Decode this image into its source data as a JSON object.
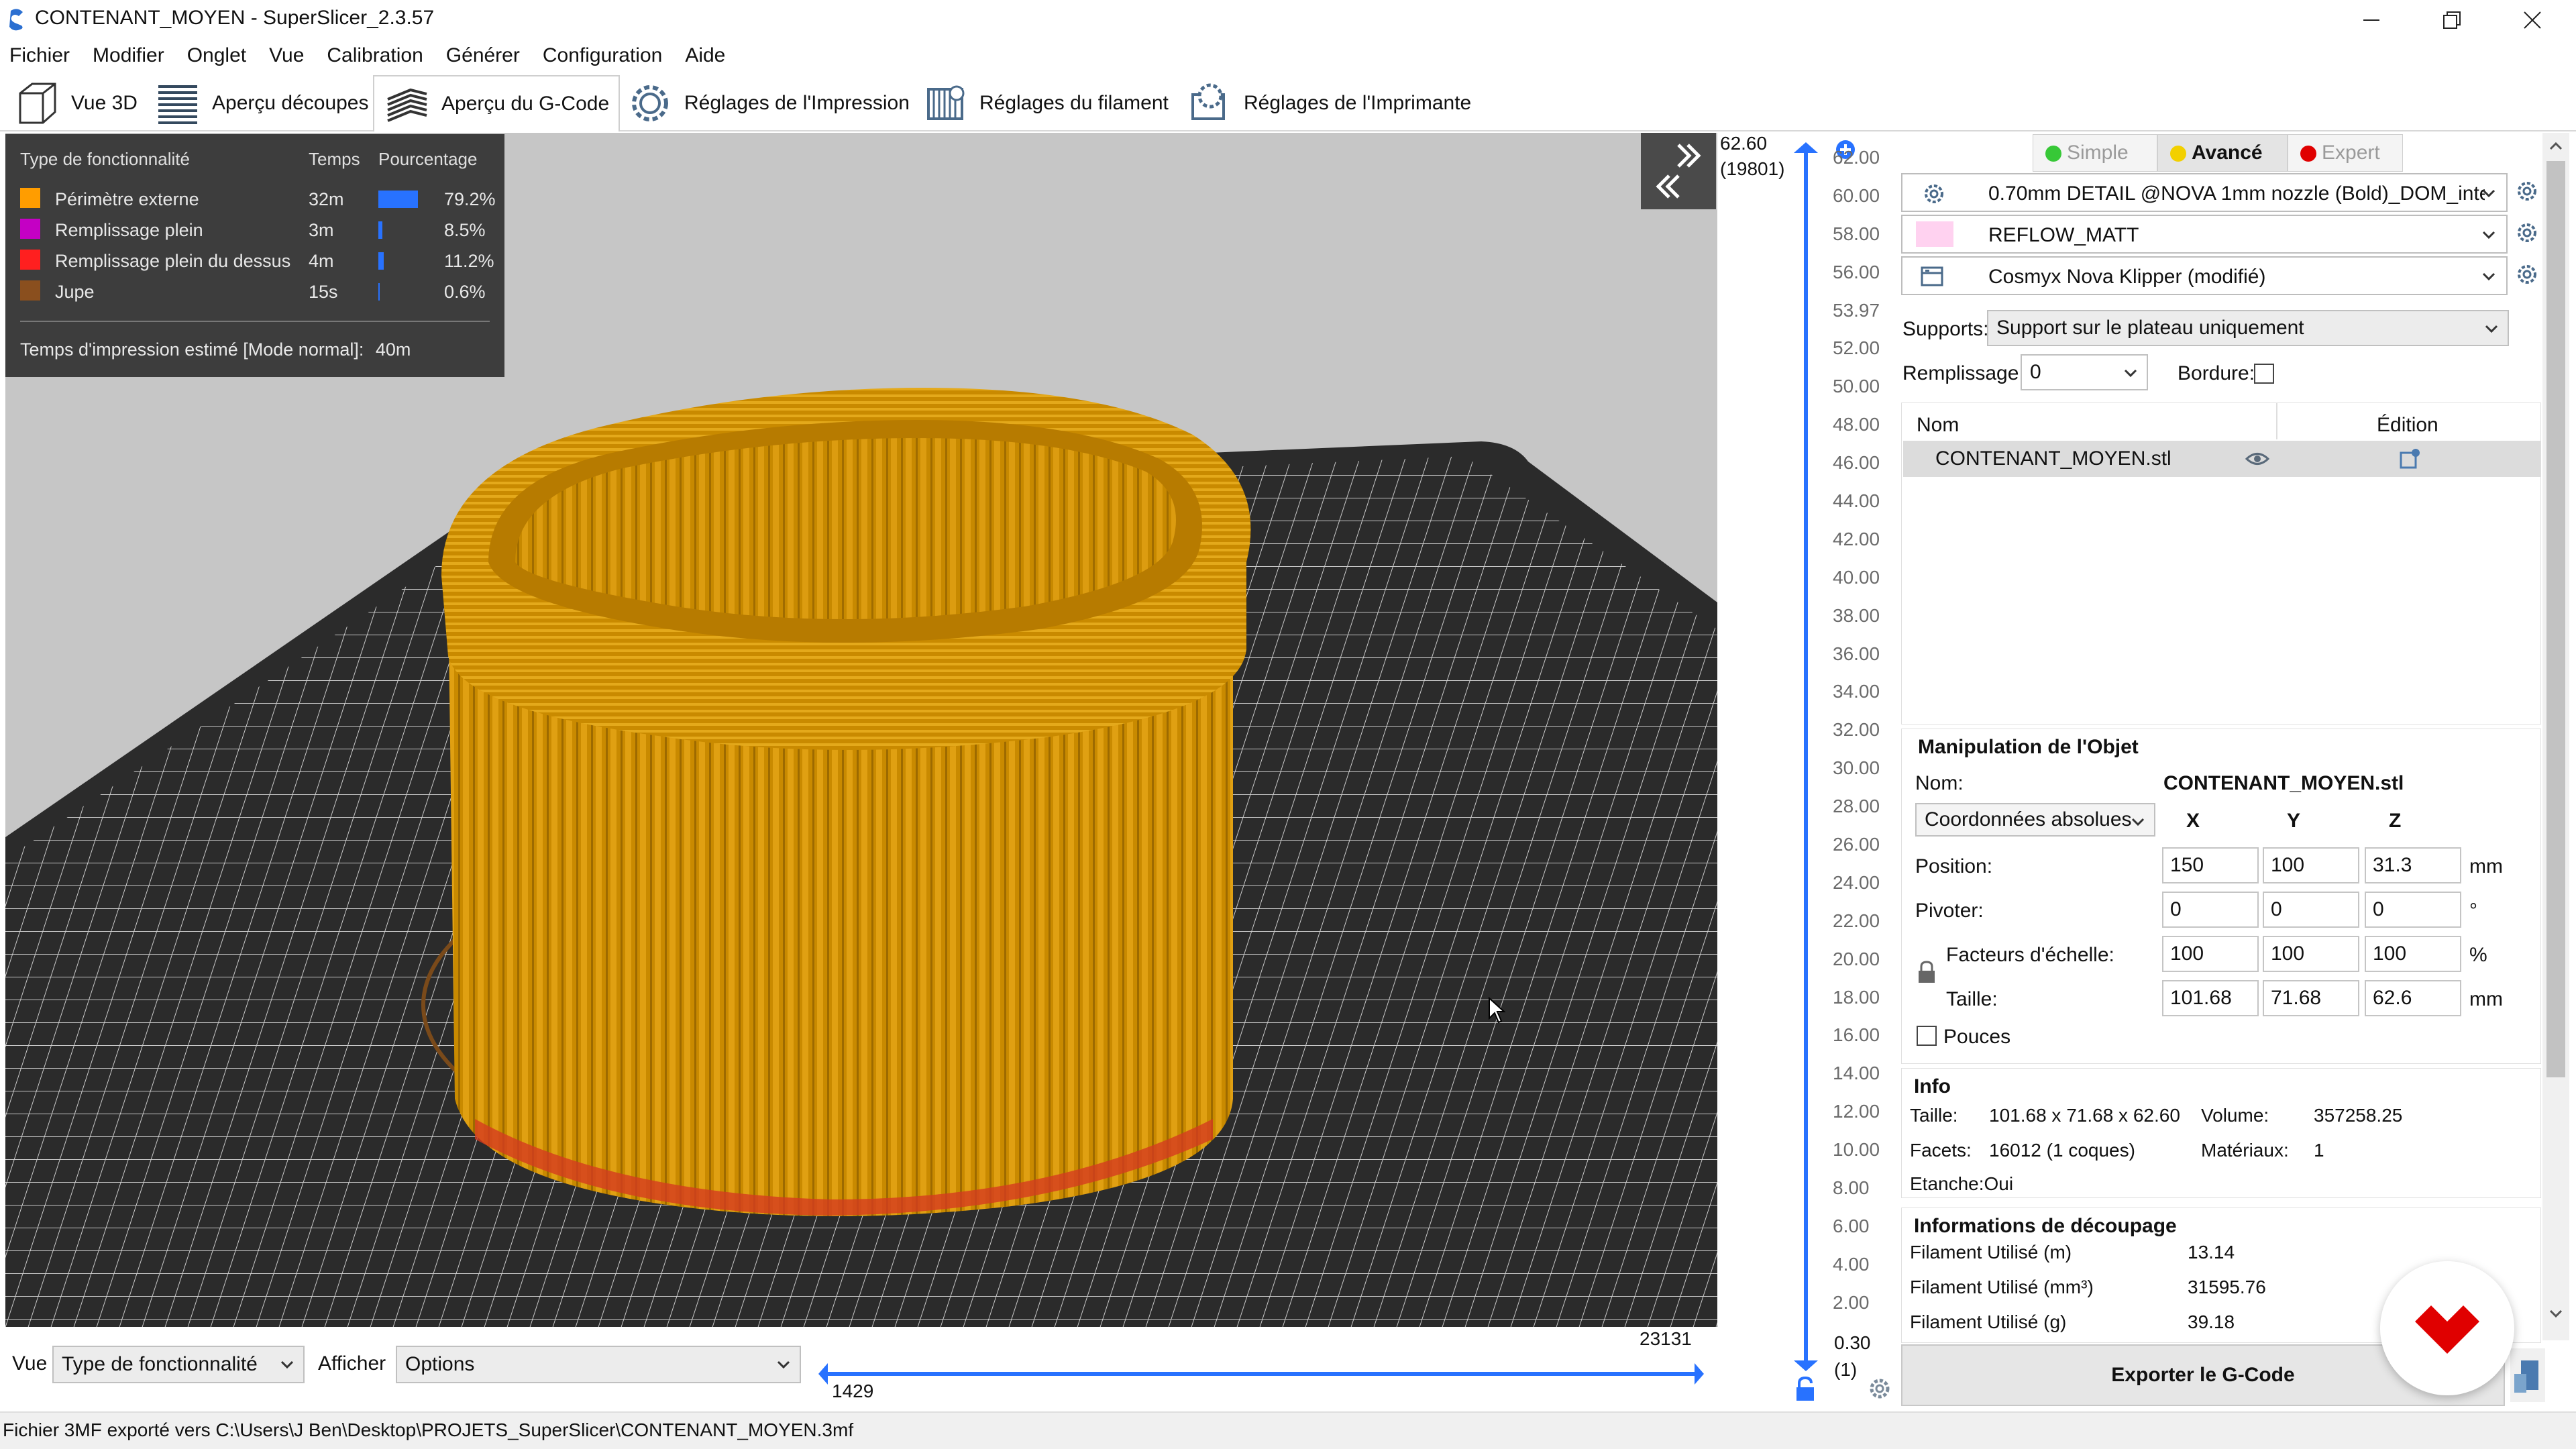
{
  "window": {
    "title": "CONTENANT_MOYEN - SuperSlicer_2.3.57",
    "icons": [
      "app-icon",
      "minimize-icon",
      "maximize-icon",
      "close-icon"
    ]
  },
  "menu": [
    "Fichier",
    "Modifier",
    "Onglet",
    "Vue",
    "Calibration",
    "Générer",
    "Configuration",
    "Aide"
  ],
  "tabs": [
    {
      "label": "Vue 3D",
      "icon": "cube-icon"
    },
    {
      "label": "Aperçu découpes",
      "icon": "layers-icon"
    },
    {
      "label": "Aperçu du G-Code",
      "icon": "gcode-layers-icon",
      "active": true
    },
    {
      "label": "Réglages de l'Impression",
      "icon": "print-settings-gear-icon"
    },
    {
      "label": "Réglages du filament",
      "icon": "filament-spool-icon"
    },
    {
      "label": "Réglages de l'Imprimante",
      "icon": "printer-gear-icon"
    }
  ],
  "legend": {
    "headers": {
      "type": "Type de fonctionnalité",
      "time": "Temps",
      "percent": "Pourcentage"
    },
    "rows": [
      {
        "name": "Périmètre externe",
        "time": "32m",
        "percent": "79.2%",
        "fraction": 0.792,
        "color": "#ff9d00"
      },
      {
        "name": "Remplissage plein",
        "time": "3m",
        "percent": "8.5%",
        "fraction": 0.085,
        "color": "#c400c4"
      },
      {
        "name": "Remplissage plein du dessus",
        "time": "4m",
        "percent": "11.2%",
        "fraction": 0.112,
        "color": "#ff1f1f"
      },
      {
        "name": "Jupe",
        "time": "15s",
        "percent": "0.6%",
        "fraction": 0.006,
        "color": "#8a4f1e"
      }
    ],
    "estimate_label": "Temps d'impression estimé [Mode normal]:",
    "estimate_value": "40m"
  },
  "vertical_slider": {
    "top_value": "62.60",
    "top_layer": "(19801)",
    "bottom_value": "0.30",
    "bottom_layer": "(1)",
    "ticks": [
      "62.00",
      "60.00",
      "58.00",
      "56.00",
      "53.97",
      "52.00",
      "50.00",
      "48.00",
      "46.00",
      "44.00",
      "42.00",
      "40.00",
      "38.00",
      "36.00",
      "34.00",
      "32.00",
      "30.00",
      "28.00",
      "26.00",
      "24.00",
      "22.00",
      "20.00",
      "18.00",
      "16.00",
      "14.00",
      "12.00",
      "10.00",
      "8.00",
      "6.00",
      "4.00",
      "2.00"
    ]
  },
  "bottom_bar": {
    "view_label": "Vue",
    "view_value": "Type de fonctionnalité",
    "show_label": "Afficher",
    "show_value": "Options",
    "hslider_top": "23131",
    "hslider_bottom": "1429"
  },
  "status": "Fichier 3MF exporté vers C:\\Users\\J Ben\\Desktop\\PROJETS_SuperSlicer\\CONTENANT_MOYEN.3mf",
  "right_panel": {
    "modes": [
      {
        "label": "Simple",
        "color": "#37c837"
      },
      {
        "label": "Avancé",
        "color": "#f2d000",
        "active": true
      },
      {
        "label": "Expert",
        "color": "#e00000"
      }
    ],
    "presets": {
      "print": "0.70mm DETAIL @NOVA 1mm nozzle (Bold)_DOM_inte",
      "filament": "REFLOW_MATT",
      "filament_color": "#ffd2f0",
      "printer": "Cosmyx Nova Klipper (modifié)"
    },
    "supports_label": "Supports:",
    "supports_value": "Support sur le plateau uniquement",
    "infill_label": "Remplissage:",
    "infill_value": "0",
    "brim_label": "Bordure:",
    "object_list": {
      "col_name": "Nom",
      "col_edit": "Édition",
      "items": [
        {
          "name": "CONTENANT_MOYEN.stl"
        }
      ]
    },
    "manipulation": {
      "title": "Manipulation de l'Objet",
      "name_label": "Nom:",
      "name_value": "CONTENANT_MOYEN.stl",
      "coord_mode": "Coordonnées absolues",
      "axes": [
        "X",
        "Y",
        "Z"
      ],
      "rows": [
        {
          "label": "Position:",
          "values": [
            "150",
            "100",
            "31.3"
          ],
          "unit": "mm"
        },
        {
          "label": "Pivoter:",
          "values": [
            "0",
            "0",
            "0"
          ],
          "unit": "°"
        },
        {
          "label": "Facteurs d'échelle:",
          "values": [
            "100",
            "100",
            "100"
          ],
          "unit": "%"
        },
        {
          "label": "Taille:",
          "values": [
            "101.68",
            "71.68",
            "62.6"
          ],
          "unit": "mm"
        }
      ],
      "inches_label": "Pouces"
    },
    "info": {
      "title": "Info",
      "size_label": "Taille:",
      "size_value": "101.68 x 71.68 x 62.60",
      "volume_label": "Volume:",
      "volume_value": "357258.25",
      "facets_label": "Facets:",
      "facets_value": "16012 (1 coques)",
      "materials_label": "Matériaux:",
      "materials_value": "1",
      "watertight_label": "Etanche:",
      "watertight_value": "Oui"
    },
    "slice_info": {
      "title": "Informations de découpage",
      "rows": [
        {
          "label": "Filament Utilisé (m)",
          "value": "13.14"
        },
        {
          "label": "Filament Utilisé (mm³)",
          "value": "31595.76"
        },
        {
          "label": "Filament Utilisé (g)",
          "value": "39.18"
        }
      ]
    },
    "export_label": "Exporter le G-Code"
  },
  "colors": {
    "print_orange": "#c98a00",
    "bed_dark": "#2b2b2b",
    "viewport_bg": "#c6c6c6",
    "slider_blue": "#2872ff",
    "brand_red": "#e00000"
  }
}
